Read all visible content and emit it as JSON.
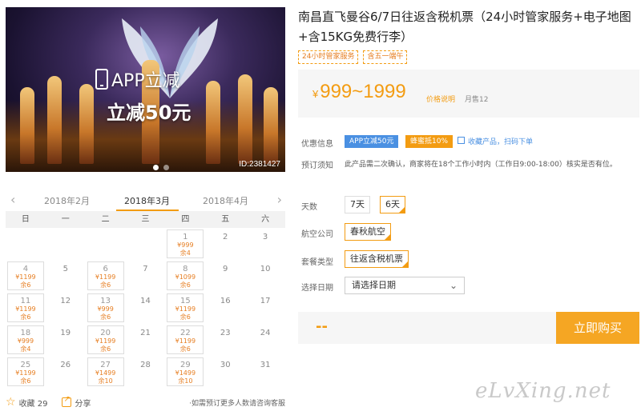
{
  "hero": {
    "promo_line1": "APP立减",
    "promo_line2": "立减50元",
    "image_id": "ID:2381427"
  },
  "calendar": {
    "prev_month": "2018年2月",
    "current_month": "2018年3月",
    "next_month": "2018年4月",
    "weekdays": [
      "日",
      "一",
      "二",
      "三",
      "四",
      "五",
      "六"
    ],
    "cells": [
      {
        "day": "",
        "price": "",
        "stock": ""
      },
      {
        "day": "",
        "price": "",
        "stock": ""
      },
      {
        "day": "",
        "price": "",
        "stock": ""
      },
      {
        "day": "",
        "price": "",
        "stock": ""
      },
      {
        "day": "1",
        "price": "¥999",
        "stock": "余4"
      },
      {
        "day": "2",
        "price": "",
        "stock": ""
      },
      {
        "day": "3",
        "price": "",
        "stock": ""
      },
      {
        "day": "4",
        "price": "¥1199",
        "stock": "余6"
      },
      {
        "day": "5",
        "price": "",
        "stock": ""
      },
      {
        "day": "6",
        "price": "¥1199",
        "stock": "余6"
      },
      {
        "day": "7",
        "price": "",
        "stock": ""
      },
      {
        "day": "8",
        "price": "¥1099",
        "stock": "余6"
      },
      {
        "day": "9",
        "price": "",
        "stock": ""
      },
      {
        "day": "10",
        "price": "",
        "stock": ""
      },
      {
        "day": "11",
        "price": "¥1199",
        "stock": "余6"
      },
      {
        "day": "12",
        "price": "",
        "stock": ""
      },
      {
        "day": "13",
        "price": "¥999",
        "stock": "余6"
      },
      {
        "day": "14",
        "price": "",
        "stock": ""
      },
      {
        "day": "15",
        "price": "¥1199",
        "stock": "余6"
      },
      {
        "day": "16",
        "price": "",
        "stock": ""
      },
      {
        "day": "17",
        "price": "",
        "stock": ""
      },
      {
        "day": "18",
        "price": "¥999",
        "stock": "余4"
      },
      {
        "day": "19",
        "price": "",
        "stock": ""
      },
      {
        "day": "20",
        "price": "¥1199",
        "stock": "余6"
      },
      {
        "day": "21",
        "price": "",
        "stock": ""
      },
      {
        "day": "22",
        "price": "¥1199",
        "stock": "余6"
      },
      {
        "day": "23",
        "price": "",
        "stock": ""
      },
      {
        "day": "24",
        "price": "",
        "stock": ""
      },
      {
        "day": "25",
        "price": "¥1199",
        "stock": "余6"
      },
      {
        "day": "26",
        "price": "",
        "stock": ""
      },
      {
        "day": "27",
        "price": "¥1499",
        "stock": "余10"
      },
      {
        "day": "28",
        "price": "",
        "stock": ""
      },
      {
        "day": "29",
        "price": "¥1499",
        "stock": "余10"
      },
      {
        "day": "30",
        "price": "",
        "stock": ""
      },
      {
        "day": "31",
        "price": "",
        "stock": ""
      }
    ]
  },
  "footer": {
    "favorite_label": "收藏 29",
    "share_label": "分享",
    "note": "·如需预订更多人数请咨询客服"
  },
  "product": {
    "title": "南昌直飞曼谷6/7日往返含税机票（24小时管家服务+电子地图+含15KG免费行李）",
    "tags": [
      "24小时管家服务",
      "含五一端午"
    ],
    "price_yen": "¥",
    "price_range": "999~1999",
    "price_link": "价格说明",
    "sales": "月售12",
    "discount_label": "优惠信息",
    "discount_badge_app": "APP立减50元",
    "discount_badge_coupon": "蜂蜜抵10%",
    "favorite_link": "收藏产品，扫码下单",
    "notice_label": "预订须知",
    "notice_text": "此产品需二次确认，商家将在18个工作小时内（工作日9:00-18:00）核实是否有位。",
    "days_label": "天数",
    "day_options": [
      "7天",
      "6天"
    ],
    "airline_label": "航空公司",
    "airline_option": "春秋航空",
    "package_label": "套餐类型",
    "package_option": "往返含税机票",
    "date_label": "选择日期",
    "date_placeholder": "请选择日期",
    "total": "--",
    "buy_label": "立即购买"
  },
  "watermark": "eLvXing.net",
  "colors": {
    "accent": "#f39c12",
    "buy_button": "#f5a623",
    "badge_blue": "#4a90e2"
  }
}
